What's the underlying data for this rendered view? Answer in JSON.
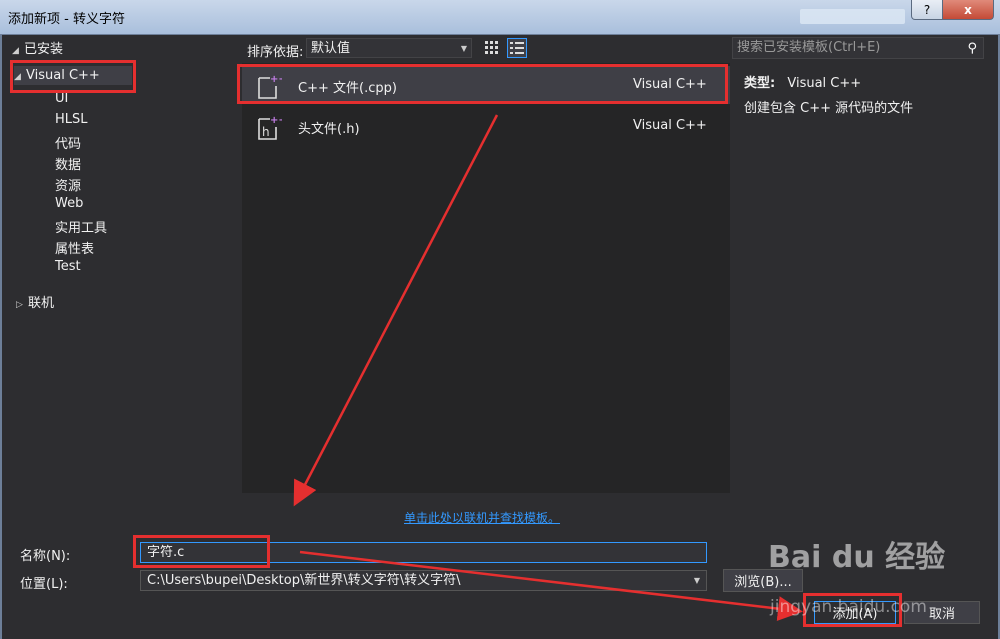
{
  "window": {
    "title": "添加新项 - 转义字符",
    "help": "?",
    "close": "x"
  },
  "tree": {
    "installed": "已安装",
    "root": "Visual C++",
    "children": [
      "UI",
      "HLSL",
      "代码",
      "数据",
      "资源",
      "Web",
      "实用工具",
      "属性表",
      "Test"
    ],
    "online": "联机"
  },
  "toolbar": {
    "sort_label": "排序依据:",
    "sort_value": "默认值",
    "search_placeholder": "搜索已安装模板(Ctrl+E)"
  },
  "templates": [
    {
      "name": "C++ 文件(.cpp)",
      "lang": "Visual C++",
      "icon": "cpp-file-icon"
    },
    {
      "name": "头文件(.h)",
      "lang": "Visual C++",
      "icon": "header-file-icon"
    }
  ],
  "info": {
    "type_label": "类型:",
    "type_value": "Visual C++",
    "description": "创建包含 C++ 源代码的文件"
  },
  "online_link": "单击此处以联机并查找模板。",
  "form": {
    "name_label": "名称(N):",
    "name_value": "字符.c",
    "location_label": "位置(L):",
    "location_value": "C:\\Users\\bupei\\Desktop\\新世界\\转义字符\\转义字符\\",
    "browse": "浏览(B)...",
    "add": "添加(A)",
    "cancel": "取消"
  },
  "watermark": {
    "text": "Bai du 经验",
    "url": "jingyan.baidu.com"
  },
  "colors": {
    "accent": "#3399ff",
    "annotation": "#e52f2f",
    "background": "#2d2d30"
  }
}
